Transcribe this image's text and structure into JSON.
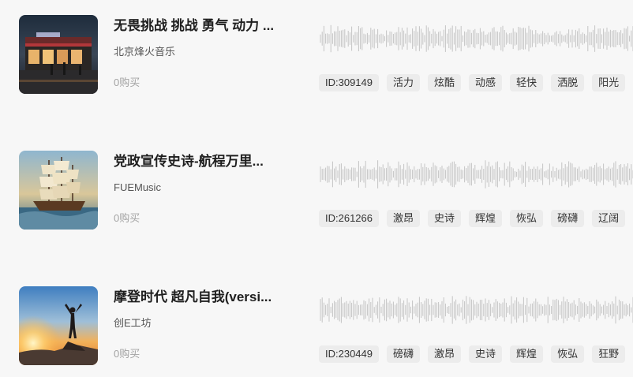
{
  "tracks": [
    {
      "title": "无畏挑战 挑战 勇气 动力 ...",
      "artist": "北京烽火音乐",
      "purchases": "0购买",
      "id_label": "ID:309149",
      "tags": [
        "活力",
        "炫酷",
        "动感",
        "轻快",
        "洒脱",
        "阳光"
      ],
      "cover_theme": "night-street-diner"
    },
    {
      "title": "党政宣传史诗-航程万里...",
      "artist": "FUEMusic",
      "purchases": "0购买",
      "id_label": "ID:261266",
      "tags": [
        "激昂",
        "史诗",
        "辉煌",
        "恢弘",
        "磅礴",
        "辽阔"
      ],
      "cover_theme": "sailing-ship"
    },
    {
      "title": "摩登时代 超凡自我(versi...",
      "artist": "创E工坊",
      "purchases": "0购买",
      "id_label": "ID:230449",
      "tags": [
        "磅礴",
        "激昂",
        "史诗",
        "辉煌",
        "恢弘",
        "狂野"
      ],
      "cover_theme": "sunset-summit"
    }
  ],
  "colors": {
    "background": "#f7f7f7",
    "title": "#1f1f1f",
    "artist": "#555555",
    "muted": "#a3a3a3",
    "tag_bg": "#ececec",
    "waveform": "#c4c4c4"
  }
}
